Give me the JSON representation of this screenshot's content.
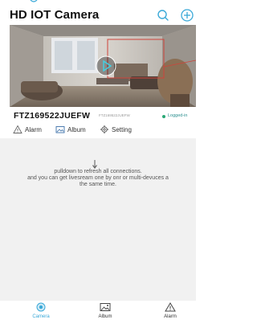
{
  "header": {
    "title": "HD IOT Camera",
    "search_icon": "search-icon",
    "add_icon": "add-icon"
  },
  "device": {
    "id": "FTZ169522JUEFW",
    "sub_id": "FTZ169522JUEFW",
    "status": "Logged-in",
    "status_color": "#2aa876"
  },
  "actions": {
    "alarm": "Alarm",
    "album": "Album",
    "setting": "Setting"
  },
  "content": {
    "hint_line1": "pulldown to refresh all connections.",
    "hint_line2": "and you can get livesream one by onr or multi-devuces a",
    "hint_line3": "the same time."
  },
  "bottom_nav": {
    "items": [
      {
        "label": "Camera",
        "icon": "camera-icon",
        "active": true
      },
      {
        "label": "Album",
        "icon": "image-icon",
        "active": false
      },
      {
        "label": "Alarm",
        "icon": "warning-icon",
        "active": false
      }
    ],
    "active_color": "#3aa9d8"
  }
}
